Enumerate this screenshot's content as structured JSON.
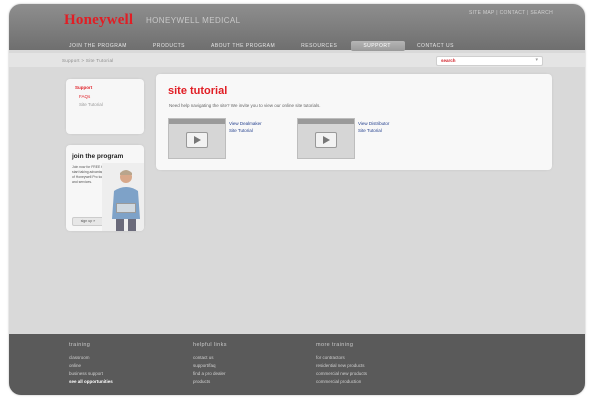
{
  "header": {
    "logo": "Honeywell",
    "tagline": "HONEYWELL MEDICAL",
    "util_links": "SITE MAP  |  CONTACT  |  SEARCH"
  },
  "nav": {
    "items": [
      {
        "label": "JOIN THE PROGRAM",
        "active": false
      },
      {
        "label": "PRODUCTS",
        "active": false
      },
      {
        "label": "ABOUT THE PROGRAM",
        "active": false
      },
      {
        "label": "RESOURCES",
        "active": false
      },
      {
        "label": "SUPPORT",
        "active": true
      },
      {
        "label": "CONTACT US",
        "active": false
      }
    ]
  },
  "breadcrumb": "Support  >  Site Tutorial",
  "search": {
    "label": "search",
    "caret": "▾"
  },
  "sidebar": {
    "title": "Support",
    "items": [
      "FAQs",
      "Site Tutorial"
    ]
  },
  "promo": {
    "title": "join the program",
    "body": "Join now for FREE to start taking advantage of Honeywell Pro tools and services.",
    "button": "sign up  »"
  },
  "main": {
    "title": "site tutorial",
    "intro": "Need help navigating the site? We invite you to view our online site tutorials.",
    "tutorials": [
      {
        "link1": "View Dealmaker",
        "link2": "Site Tutorial"
      },
      {
        "link1": "View Distributor",
        "link2": "Site Tutorial"
      }
    ]
  },
  "footer": {
    "columns": [
      {
        "heading": "training",
        "links": [
          "classroom",
          "online",
          "business support",
          "see all opportunities"
        ]
      },
      {
        "heading": "helpful links",
        "links": [
          "contact us",
          "support/faq",
          "find a pro dealer",
          "products"
        ]
      },
      {
        "heading": "more training",
        "links": [
          "for contractors",
          "residential new products",
          "commercial new products",
          "commercial production"
        ]
      }
    ]
  },
  "colors": {
    "brand_red": "#e11d24",
    "link_blue": "#24408e",
    "header_gray": "#7a7a7a",
    "footer_gray": "#5a5a5a"
  }
}
